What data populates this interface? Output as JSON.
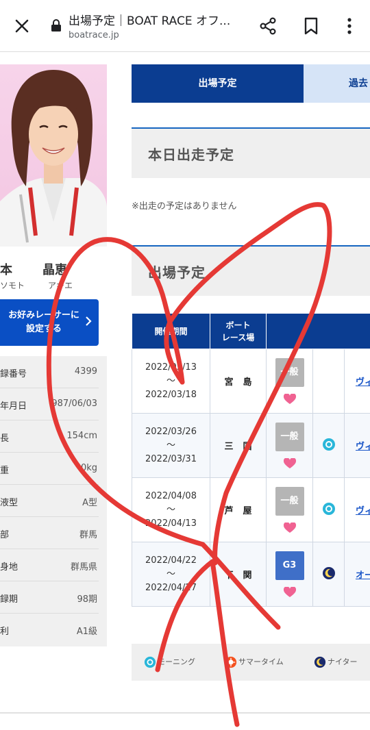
{
  "browser": {
    "title": "出場予定｜BOAT RACE オフ...",
    "url": "boatrace.jp"
  },
  "racer": {
    "name_a": "本",
    "name_b": "晶恵",
    "kana_a": "ソモト",
    "kana_b": "アキエ",
    "favorite_button": "お好みレーサーに設定する"
  },
  "profile": [
    {
      "label": "録番号",
      "value": "4399"
    },
    {
      "label": "年月日",
      "value": "987/06/03"
    },
    {
      "label": "長",
      "value": "154cm"
    },
    {
      "label": "重",
      "value": "0kg"
    },
    {
      "label": "液型",
      "value": "A型"
    },
    {
      "label": "部",
      "value": "群馬"
    },
    {
      "label": "身地",
      "value": "群馬県"
    },
    {
      "label": "録期",
      "value": "98期"
    },
    {
      "label": "利",
      "value": "A1級"
    }
  ],
  "tabs": {
    "active": "出場予定",
    "inactive": "過去"
  },
  "today": {
    "heading": "本日出走予定",
    "note": "※出走の予定はありません"
  },
  "schedule": {
    "heading": "出場予定",
    "col_period": "開催期間",
    "col_venue_1": "ボート",
    "col_venue_2": "レース場",
    "rows": [
      {
        "start": "2022/03/13",
        "sep": "〜",
        "end": "2022/03/18",
        "venue": "宮島",
        "grade": "一般",
        "time_icon": "",
        "link": "ヴィ"
      },
      {
        "start": "2022/03/26",
        "sep": "〜",
        "end": "2022/03/31",
        "venue": "三国",
        "grade": "一般",
        "time_icon": "morning-icon",
        "link": "ヴィ"
      },
      {
        "start": "2022/04/08",
        "sep": "〜",
        "end": "2022/04/13",
        "venue": "芦屋",
        "grade": "一般",
        "time_icon": "morning-icon",
        "link": "ヴィ"
      },
      {
        "start": "2022/04/22",
        "sep": "〜",
        "end": "2022/04/27",
        "venue": "下関",
        "grade": "G3",
        "time_icon": "night-icon",
        "link": "オー"
      }
    ]
  },
  "legend": {
    "morning": "モーニング",
    "summer": "サマータイム",
    "night": "ナイター"
  },
  "colors": {
    "navy": "#0b3d91",
    "button_blue": "#0a4fc4",
    "scribble_red": "#e53935",
    "heart_pink": "#f06292"
  }
}
